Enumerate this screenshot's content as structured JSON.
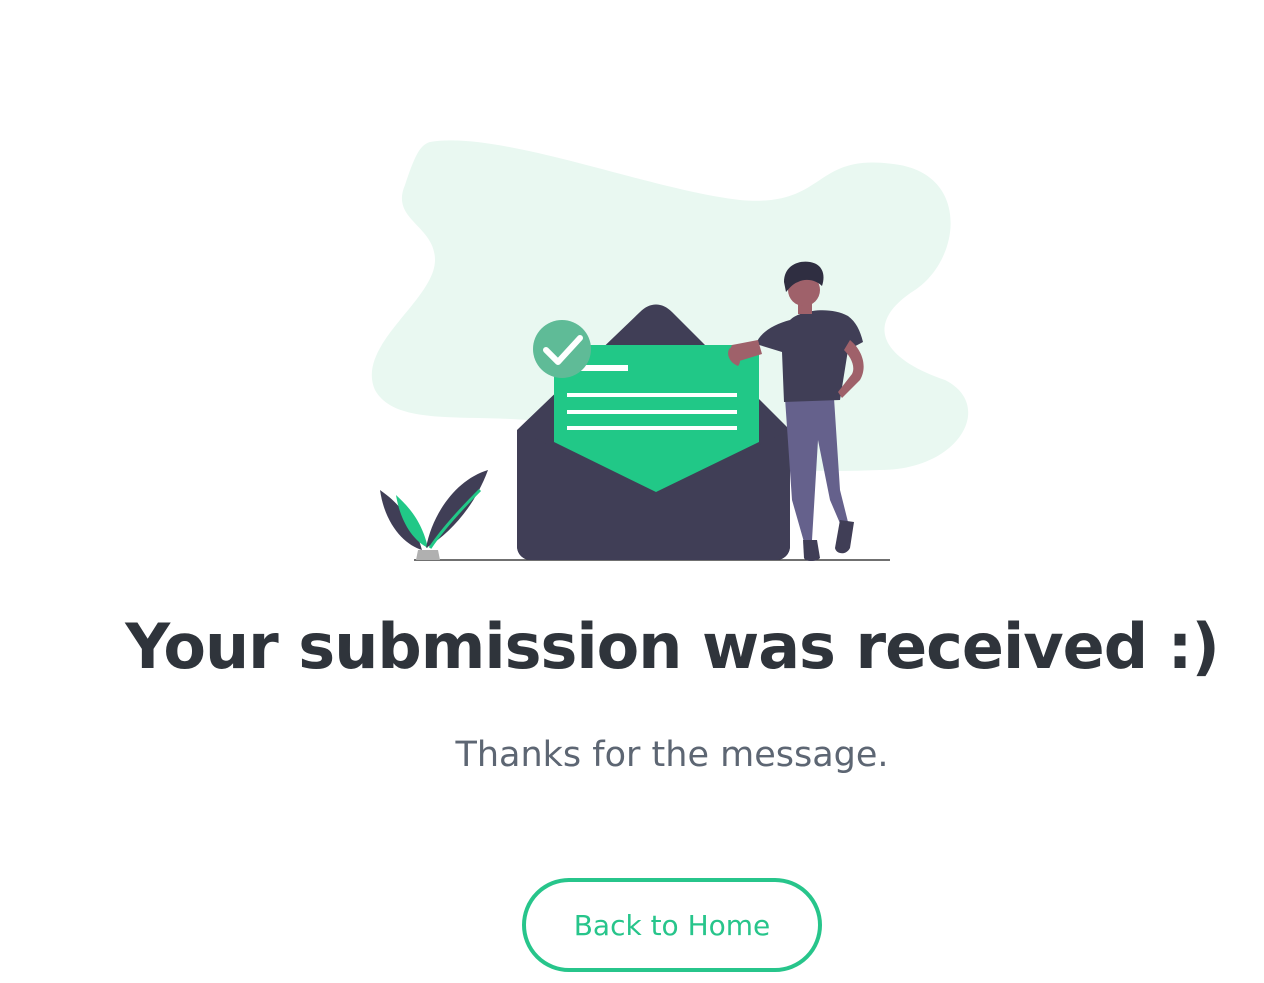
{
  "confirmation": {
    "headline": "Your submission was received :)",
    "subtext": "Thanks for the message.",
    "back_button_label": "Back to Home"
  },
  "illustration": {
    "icons": [
      "check-circle-icon",
      "envelope-icon",
      "letter-icon",
      "person-figure",
      "plant-icon",
      "background-blob"
    ]
  },
  "colors": {
    "accent": "#27c58b",
    "envelope": "#403e56",
    "blob": "#e9f8f1",
    "headline": "#2f343b",
    "subtext": "#5d6673"
  }
}
